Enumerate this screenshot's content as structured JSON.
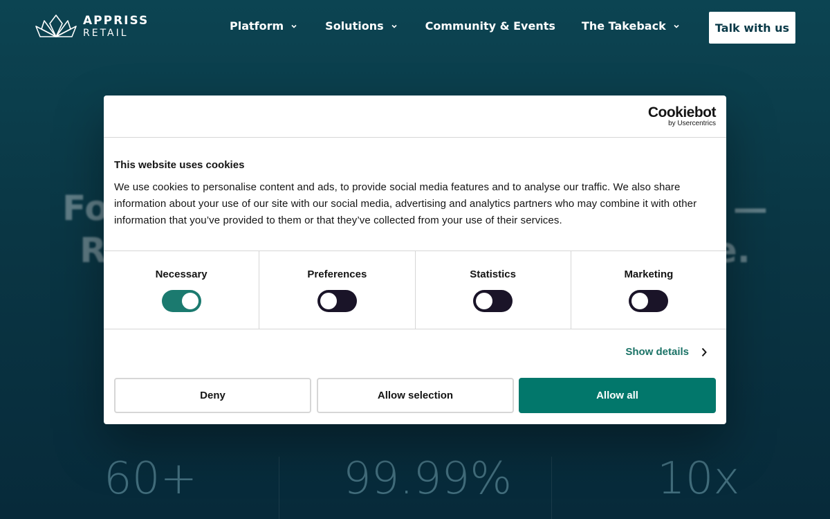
{
  "header": {
    "logo_top": "APPRISS",
    "logo_bottom": "RETAIL",
    "nav": [
      {
        "label": "Platform",
        "has_dropdown": true
      },
      {
        "label": "Solutions",
        "has_dropdown": true
      },
      {
        "label": "Community & Events",
        "has_dropdown": false
      },
      {
        "label": "The Takeback",
        "has_dropdown": true
      }
    ],
    "cta_label": "Talk with us"
  },
  "hero": {
    "line1": "For ",
    "line1_end": "e —",
    "line2": "R",
    "line2_end": "e."
  },
  "stats": [
    {
      "value": "60+"
    },
    {
      "value": "99.99%"
    },
    {
      "value": "10x"
    }
  ],
  "cookie_dialog": {
    "brand": "Cookiebot",
    "brand_sub": "by Usercentrics",
    "title": "This website uses cookies",
    "text": "We use cookies to personalise content and ads, to provide social media features and to analyse our traffic. We also share information about your use of our site with our social media, advertising and analytics partners who may combine it with other information that you’ve provided to them or that they’ve collected from your use of their services.",
    "categories": [
      {
        "label": "Necessary",
        "enabled": true
      },
      {
        "label": "Preferences",
        "enabled": false
      },
      {
        "label": "Statistics",
        "enabled": false
      },
      {
        "label": "Marketing",
        "enabled": false
      }
    ],
    "show_details_label": "Show details",
    "buttons": {
      "deny": "Deny",
      "allow_selection": "Allow selection",
      "allow_all": "Allow all"
    }
  },
  "colors": {
    "accent": "#02776b",
    "toggle_on": "#1b7a6f",
    "toggle_off": "#1a1428",
    "background_top": "#0c4452",
    "background_bottom": "#072a3a"
  }
}
